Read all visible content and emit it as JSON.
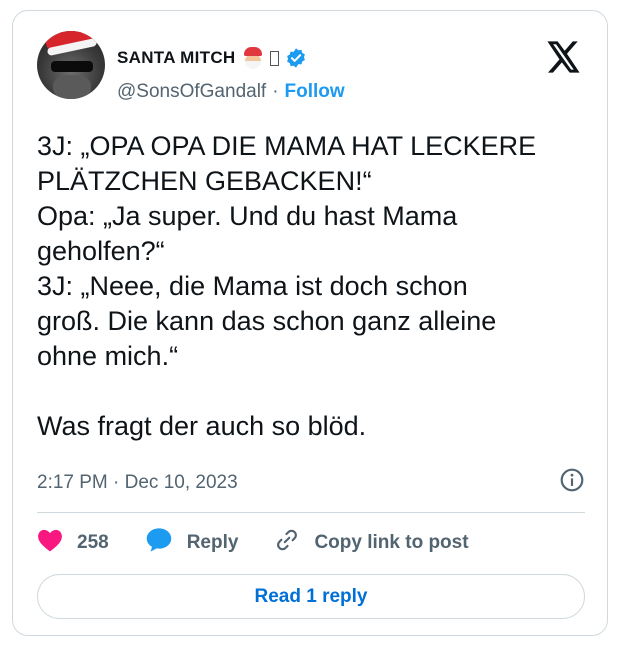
{
  "author": {
    "display_name": "SANTA MITCH",
    "handle": "@SonsOfGandalf",
    "separator": "·",
    "follow_label": "Follow"
  },
  "post": {
    "text": "3J: „OPA OPA DIE MAMA HAT LECKERE\nPLÄTZCHEN GEBACKEN!“\nOpa: „Ja super. Und du hast Mama\ngeholfen?“\n3J: „Neee, die Mama ist doch schon\ngroß. Die kann das schon ganz alleine\nohne mich.“\n\nWas fragt der auch so blöd.",
    "timestamp": "2:17 PM · Dec 10, 2023"
  },
  "actions": {
    "like_count": "258",
    "reply_label": "Reply",
    "copy_link_label": "Copy link to post"
  },
  "read_reply_label": "Read 1 reply",
  "colors": {
    "like": "#f91880",
    "reply": "#1d9bf0",
    "link": "#006fd6",
    "verified": "#1d9bf0"
  },
  "icons": [
    "santa-emoji-icon",
    "verified-badge-icon",
    "x-logo-icon",
    "info-icon",
    "heart-icon",
    "reply-bubble-icon",
    "link-icon"
  ]
}
